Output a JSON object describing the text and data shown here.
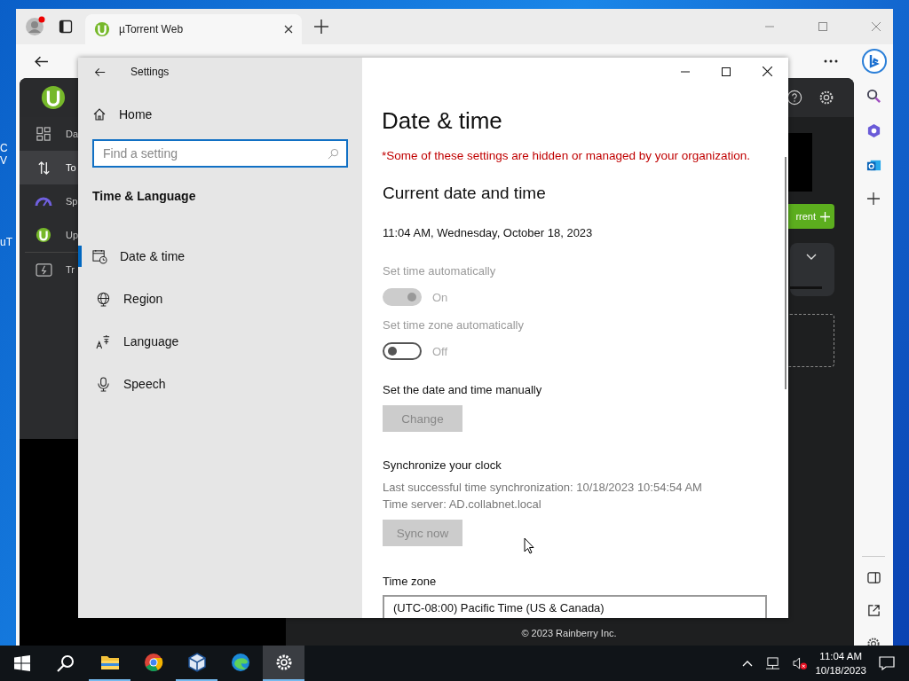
{
  "desktop_labels": [
    "C",
    "V",
    "uT"
  ],
  "browser": {
    "tab_title": "µTorrent Web"
  },
  "utorrent": {
    "nav": [
      {
        "kind": "dashboard",
        "label": "Da",
        "selected": false
      },
      {
        "kind": "transfer",
        "label": "To",
        "selected": true
      },
      {
        "kind": "speed",
        "label": "Sp",
        "selected": false
      },
      {
        "kind": "logo",
        "label": "Up",
        "selected": false
      },
      {
        "kind": "card",
        "label": "Tr",
        "selected": false
      }
    ],
    "add_button": "rrent",
    "footer": "© 2023 Rainberry Inc."
  },
  "settings": {
    "title": "Settings",
    "home": "Home",
    "search": {
      "placeholder": "Find a setting"
    },
    "section": "Time & Language",
    "nav": [
      {
        "kind": "calendar",
        "label": "Date & time",
        "selected": true
      },
      {
        "kind": "globe",
        "label": "Region",
        "selected": false
      },
      {
        "kind": "language",
        "label": "Language",
        "selected": false
      },
      {
        "kind": "mic",
        "label": "Speech",
        "selected": false
      }
    ],
    "page_title": "Date & time",
    "notice": "*Some of these settings are hidden or managed by your organization.",
    "heading": "Current date and time",
    "current": "11:04 AM, Wednesday, October 18, 2023",
    "toggles": [
      {
        "label": "Set time automatically",
        "on": true,
        "state_text": "On"
      },
      {
        "label": "Set time zone automatically",
        "on": false,
        "state_text": "Off"
      }
    ],
    "manual": {
      "label": "Set the date and time manually",
      "button": "Change"
    },
    "sync": {
      "heading": "Synchronize your clock",
      "last_sync": "Last successful time synchronization: 10/18/2023 10:54:54 AM",
      "server": "Time server: AD.collabnet.local",
      "button": "Sync now"
    },
    "time_zone": {
      "label": "Time zone",
      "value": "(UTC-08:00) Pacific Time (US & Canada)"
    }
  },
  "taskbar": {
    "apps": [
      {
        "kind": "files",
        "running": true,
        "selected": false
      },
      {
        "kind": "chrome",
        "running": false,
        "selected": false
      },
      {
        "kind": "cube",
        "running": true,
        "selected": false
      },
      {
        "kind": "edge",
        "running": false,
        "selected": false
      },
      {
        "kind": "settings",
        "running": true,
        "selected": true
      }
    ],
    "time": "11:04 AM",
    "date": "10/18/2023"
  }
}
